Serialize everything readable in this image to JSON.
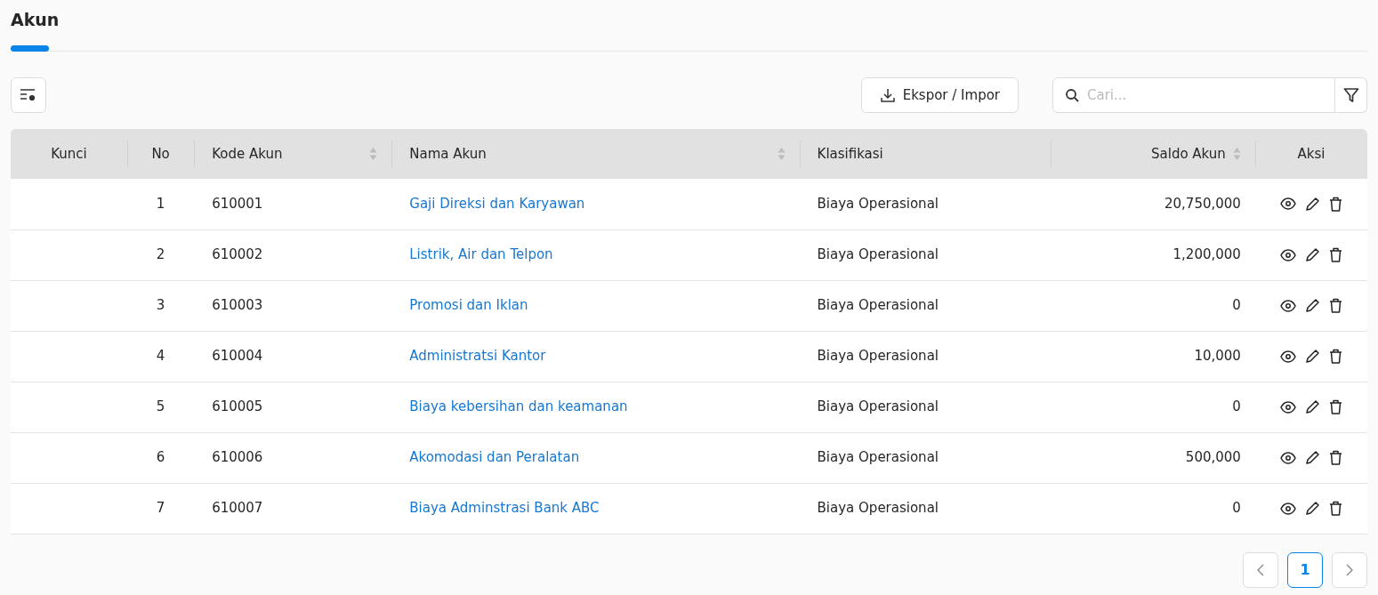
{
  "title": "Akun",
  "toolbar": {
    "export_button": "Ekspor / Impor",
    "search": {
      "placeholder": "Cari..."
    }
  },
  "table": {
    "columns": [
      {
        "label": "Kunci",
        "sortable": false
      },
      {
        "label": "No",
        "sortable": false
      },
      {
        "label": "Kode Akun",
        "sortable": true
      },
      {
        "label": "Nama Akun",
        "sortable": true
      },
      {
        "label": "Klasifikasi",
        "sortable": false
      },
      {
        "label": "Saldo Akun",
        "sortable": true
      },
      {
        "label": "Aksi",
        "sortable": false
      }
    ],
    "rows": [
      {
        "no": "1",
        "code": "610001",
        "name": "Gaji Direksi dan Karyawan",
        "classification": "Biaya Operasional",
        "balance": "20,750,000"
      },
      {
        "no": "2",
        "code": "610002",
        "name": "Listrik, Air dan Telpon",
        "classification": "Biaya Operasional",
        "balance": "1,200,000"
      },
      {
        "no": "3",
        "code": "610003",
        "name": "Promosi dan Iklan",
        "classification": "Biaya Operasional",
        "balance": "0"
      },
      {
        "no": "4",
        "code": "610004",
        "name": "Administratsi Kantor",
        "classification": "Biaya Operasional",
        "balance": "10,000"
      },
      {
        "no": "5",
        "code": "610005",
        "name": "Biaya kebersihan dan keamanan",
        "classification": "Biaya Operasional",
        "balance": "0"
      },
      {
        "no": "6",
        "code": "610006",
        "name": "Akomodasi dan Peralatan",
        "classification": "Biaya Operasional",
        "balance": "500,000"
      },
      {
        "no": "7",
        "code": "610007",
        "name": "Biaya Adminstrasi Bank ABC",
        "classification": "Biaya Operasional",
        "balance": "0"
      }
    ]
  },
  "pagination": {
    "pages": [
      {
        "label": "1",
        "selected": true
      }
    ]
  }
}
